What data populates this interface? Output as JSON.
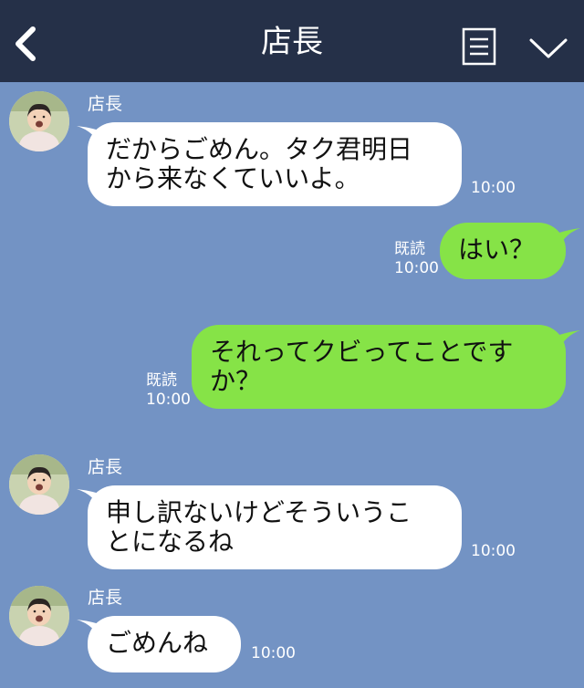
{
  "header": {
    "title": "店長",
    "back_icon": "chevron-left-icon",
    "menu_icon": "list-icon",
    "expand_icon": "chevron-down-icon"
  },
  "colors": {
    "header_bg": "#253048",
    "chat_bg": "#7393c4",
    "incoming_bubble": "#ffffff",
    "outgoing_bubble": "#86e347"
  },
  "messages": [
    {
      "direction": "incoming",
      "sender": "店長",
      "text": "だからごめん。タク君明日\nから来なくていいよ。",
      "time": "10:00"
    },
    {
      "direction": "outgoing",
      "read_label": "既読",
      "text": "はい？",
      "time": "10:00"
    },
    {
      "direction": "outgoing",
      "read_label": "既読",
      "text": "それってクビってことです\nか？",
      "time": "10:00"
    },
    {
      "direction": "incoming",
      "sender": "店長",
      "text": "申し訳ないけどそういうこ\nとになるね",
      "time": "10:00"
    },
    {
      "direction": "incoming",
      "sender": "店長",
      "text": "ごめんね",
      "time": "10:00"
    }
  ]
}
